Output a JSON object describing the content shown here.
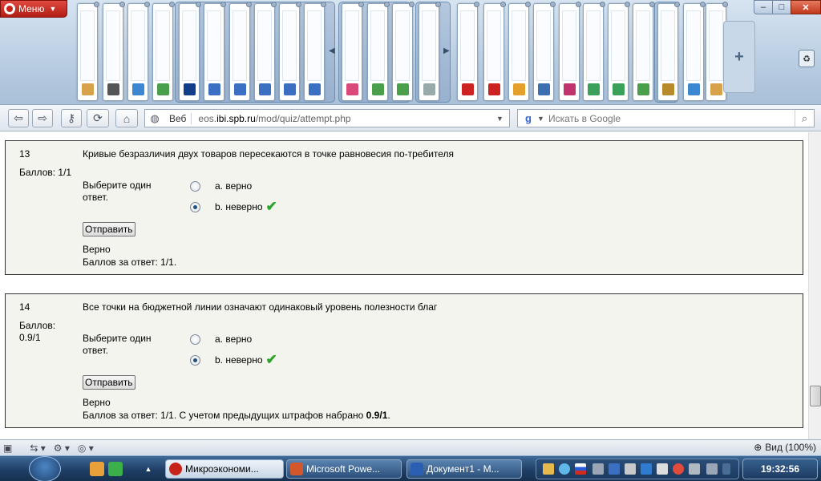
{
  "browser": {
    "menu_label": "Меню",
    "window_controls": {
      "minimize": "–",
      "maximize": "□",
      "close": "✕"
    },
    "new_tab_label": "+",
    "address": {
      "mode_label": "Веб",
      "url_prefix": "eos.",
      "url_domain": "ibi.spb.ru",
      "url_path": "/mod/quiz/attempt.php"
    },
    "search": {
      "engine": "g",
      "placeholder": "Искать в Google"
    },
    "zoom_label": "Вид (100%)"
  },
  "questions": [
    {
      "number": "13",
      "text": "Кривые безразличия двух товаров пересекаются в точке равновесия по-требителя",
      "grade_line1": "Баллов: 1/1",
      "grade_line2": "",
      "prompt": "Выберите один ответ.",
      "options": [
        {
          "label": "a. верно",
          "selected": false
        },
        {
          "label": "b. неверно",
          "selected": true,
          "mark": "✔"
        }
      ],
      "submit_label": "Отправить",
      "feedback_status": "Верно",
      "feedback_score": "Баллов за ответ: 1/1.",
      "feedback_extra": "",
      "feedback_bold": ""
    },
    {
      "number": "14",
      "text": "Все точки на бюджетной линии означают одинаковый уровень полезности благ",
      "grade_line1": "Баллов:",
      "grade_line2": "0.9/1",
      "prompt": "Выберите один ответ.",
      "options": [
        {
          "label": "a. верно",
          "selected": false
        },
        {
          "label": "b. неверно",
          "selected": true,
          "mark": "✔"
        }
      ],
      "submit_label": "Отправить",
      "feedback_status": "Верно",
      "feedback_score": "Баллов за ответ: 1/1. С учетом предыдущих штрафов набрано ",
      "feedback_extra": "",
      "feedback_bold": "0.9/1",
      "feedback_tail": "."
    }
  ],
  "taskbar": {
    "tasks": [
      {
        "label": "Микроэкономи...",
        "active": true
      },
      {
        "label": "Microsoft Powe...",
        "active": false
      },
      {
        "label": "Документ1 - M...",
        "active": false
      }
    ],
    "clock": "19:32:56"
  },
  "colors": {
    "opera_red": "#c7231a",
    "check_green": "#2aa52a",
    "question_bg": "#f4f4ee"
  }
}
